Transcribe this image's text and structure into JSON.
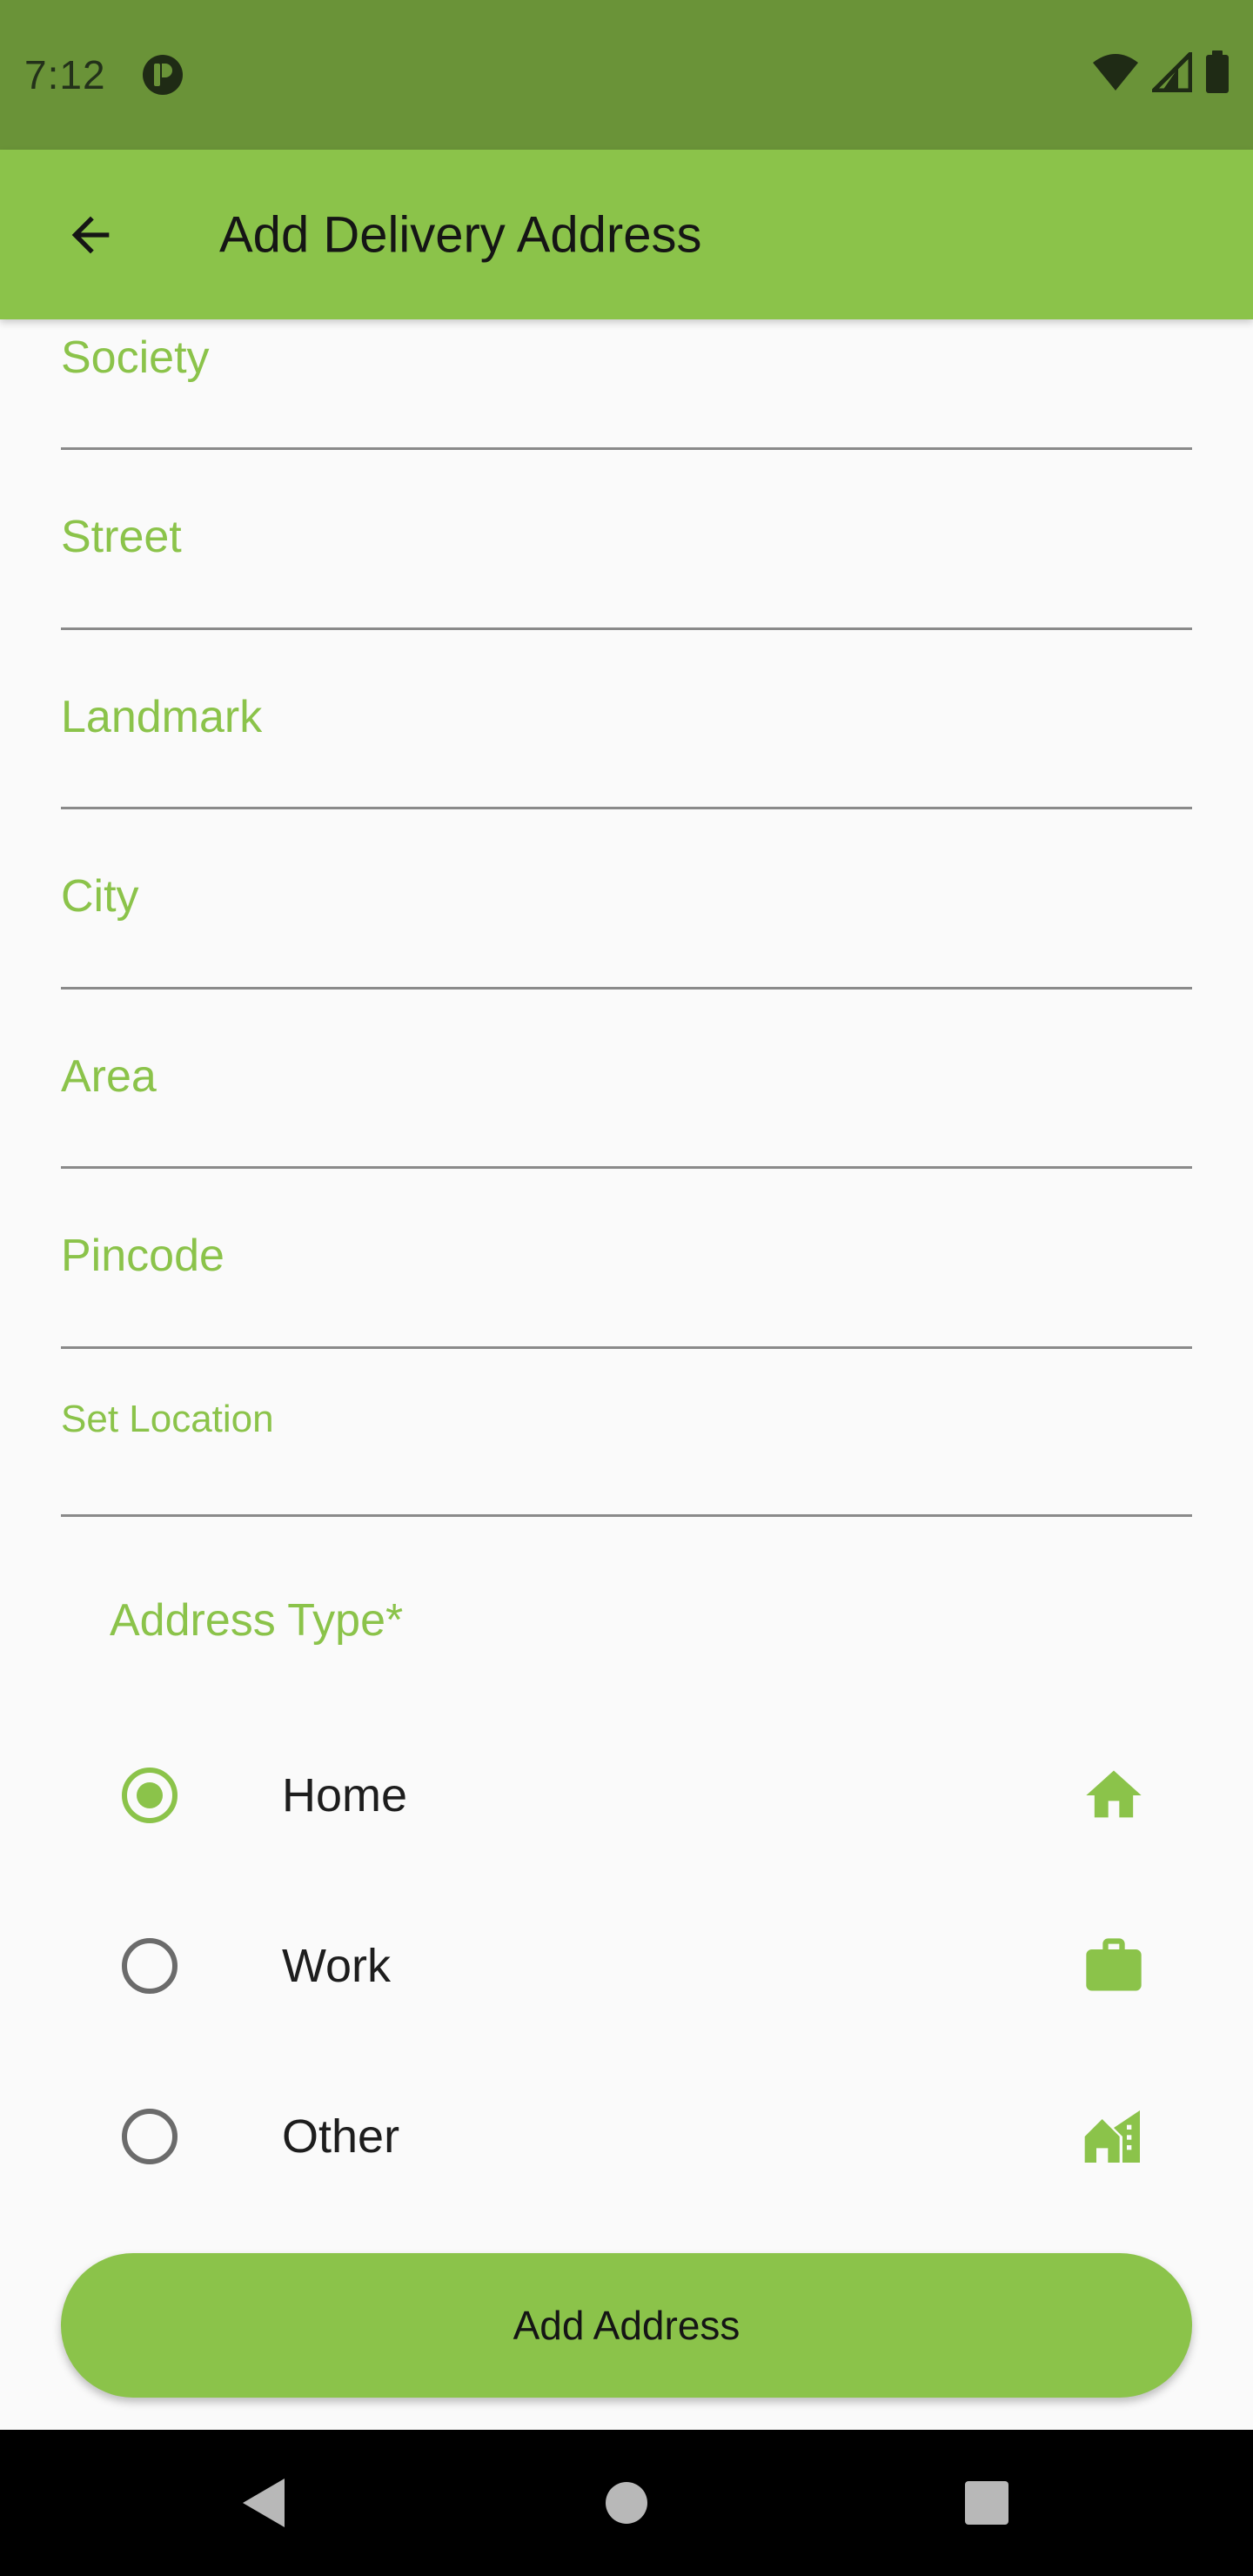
{
  "status_bar": {
    "time": "7:12",
    "app_icon": "circle-p-icon",
    "icons": [
      "wifi-icon",
      "signal-icon",
      "battery-icon"
    ]
  },
  "app_bar": {
    "back_icon": "arrow-left-icon",
    "title": "Add Delivery Address"
  },
  "form": {
    "fields": [
      {
        "label": "Society"
      },
      {
        "label": "Street"
      },
      {
        "label": "Landmark"
      },
      {
        "label": "City"
      },
      {
        "label": "Area"
      },
      {
        "label": "Pincode"
      },
      {
        "label": "Set Location"
      }
    ],
    "address_type_label": "Address Type*",
    "options": [
      {
        "label": "Home",
        "icon": "home-icon",
        "selected": true
      },
      {
        "label": "Work",
        "icon": "briefcase-icon",
        "selected": false
      },
      {
        "label": "Other",
        "icon": "building-icon",
        "selected": false
      }
    ]
  },
  "submit": {
    "label": "Add Address"
  },
  "nav_bar": {
    "buttons": [
      "back-triangle-icon",
      "home-circle-icon",
      "recents-square-icon"
    ]
  },
  "colors": {
    "accent": "#8bc34a",
    "status_bar": "#6a9338",
    "divider": "#8a8a8a"
  }
}
